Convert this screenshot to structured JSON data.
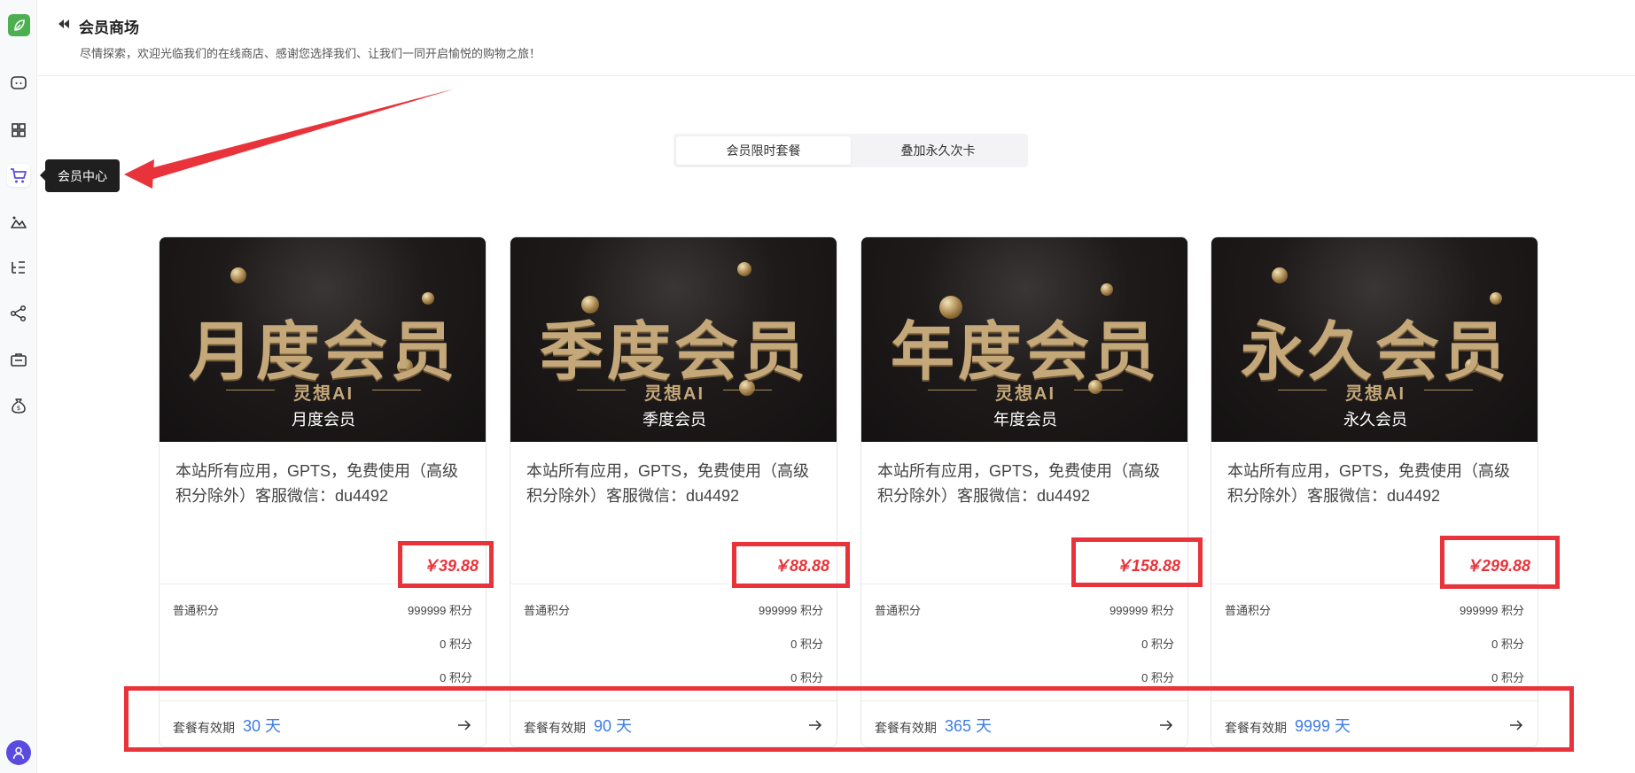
{
  "sidebar": {
    "items": [
      {
        "icon": "chat-icon"
      },
      {
        "icon": "apps-grid-icon"
      },
      {
        "icon": "cart-icon",
        "active": true
      },
      {
        "icon": "image-mountain-icon"
      },
      {
        "icon": "list-tree-icon"
      },
      {
        "icon": "share-icon"
      },
      {
        "icon": "briefcase-icon"
      },
      {
        "icon": "money-bag-icon"
      }
    ],
    "tooltip": "会员中心",
    "accent_color": "#5a4be0"
  },
  "header": {
    "title": "会员商场",
    "subtitle": "尽情探索，欢迎光临我们的在线商店、感谢您选择我们、让我们一同开启愉悦的购物之旅！"
  },
  "tabs": [
    {
      "label": "会员限时套餐",
      "active": true
    },
    {
      "label": "叠加永久次卡",
      "active": false
    }
  ],
  "cards": [
    {
      "banner_big": "月度会员",
      "banner_brand": "灵想AI",
      "caption": "月度会员",
      "description": "本站所有应用，GPTS，免费使用（高级积分除外）客服微信：du4492",
      "price": "￥39.88",
      "rows": [
        {
          "label": "普通积分",
          "value": "999999 积分"
        },
        {
          "label": "",
          "value": "0 积分"
        },
        {
          "label": "",
          "value": "0 积分"
        }
      ],
      "validity_label": "套餐有效期",
      "validity_value": "30 天"
    },
    {
      "banner_big": "季度会员",
      "banner_brand": "灵想AI",
      "caption": "季度会员",
      "description": "本站所有应用，GPTS，免费使用（高级积分除外）客服微信：du4492",
      "price": "￥88.88",
      "rows": [
        {
          "label": "普通积分",
          "value": "999999 积分"
        },
        {
          "label": "",
          "value": "0 积分"
        },
        {
          "label": "",
          "value": "0 积分"
        }
      ],
      "validity_label": "套餐有效期",
      "validity_value": "90 天"
    },
    {
      "banner_big": "年度会员",
      "banner_brand": "灵想AI",
      "caption": "年度会员",
      "description": "本站所有应用，GPTS，免费使用（高级积分除外）客服微信：du4492",
      "price": "￥158.88",
      "rows": [
        {
          "label": "普通积分",
          "value": "999999 积分"
        },
        {
          "label": "",
          "value": "0 积分"
        },
        {
          "label": "",
          "value": "0 积分"
        }
      ],
      "validity_label": "套餐有效期",
      "validity_value": "365 天"
    },
    {
      "banner_big": "永久会员",
      "banner_brand": "灵想AI",
      "caption": "永久会员",
      "description": "本站所有应用，GPTS，免费使用（高级积分除外）客服微信：du4492",
      "price": "￥299.88",
      "rows": [
        {
          "label": "普通积分",
          "value": "999999 积分"
        },
        {
          "label": "",
          "value": "0 积分"
        },
        {
          "label": "",
          "value": "0 积分"
        }
      ],
      "validity_label": "套餐有效期",
      "validity_value": "9999 天"
    }
  ],
  "colors": {
    "price": "#e8333a",
    "validity": "#3d7be6",
    "annotation": "#e8333a"
  }
}
